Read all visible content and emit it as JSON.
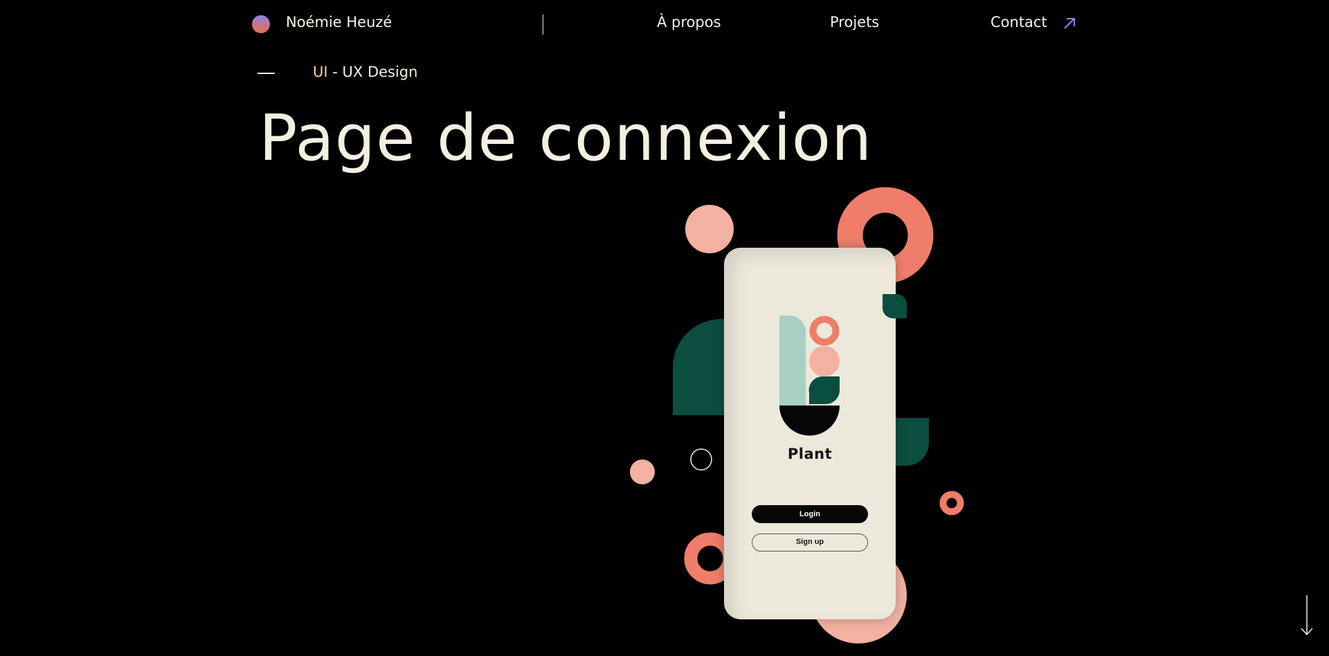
{
  "header": {
    "brand": "Noémie Heuzé",
    "nav": [
      {
        "label": "À propos"
      },
      {
        "label": "Projets"
      },
      {
        "label": "Contact"
      }
    ],
    "contact_icon": "arrow-up-right-icon"
  },
  "hero": {
    "category_part1": "UI",
    "category_part2": " - UX Design",
    "title": "Page de connexion"
  },
  "mockup": {
    "app_name": "Plant",
    "login_label": "Login",
    "signup_label": "Sign up"
  },
  "scroll_icon": "arrow-down-icon",
  "colors": {
    "background": "#000000",
    "text": "#f3efe2",
    "accent_yellow": "#f2d58b",
    "coral": "#ee7e69",
    "pink": "#f2b1a1",
    "dark_green": "#0a4e3f",
    "mint": "#a8d0c2",
    "phone_bg": "#ece9db"
  }
}
